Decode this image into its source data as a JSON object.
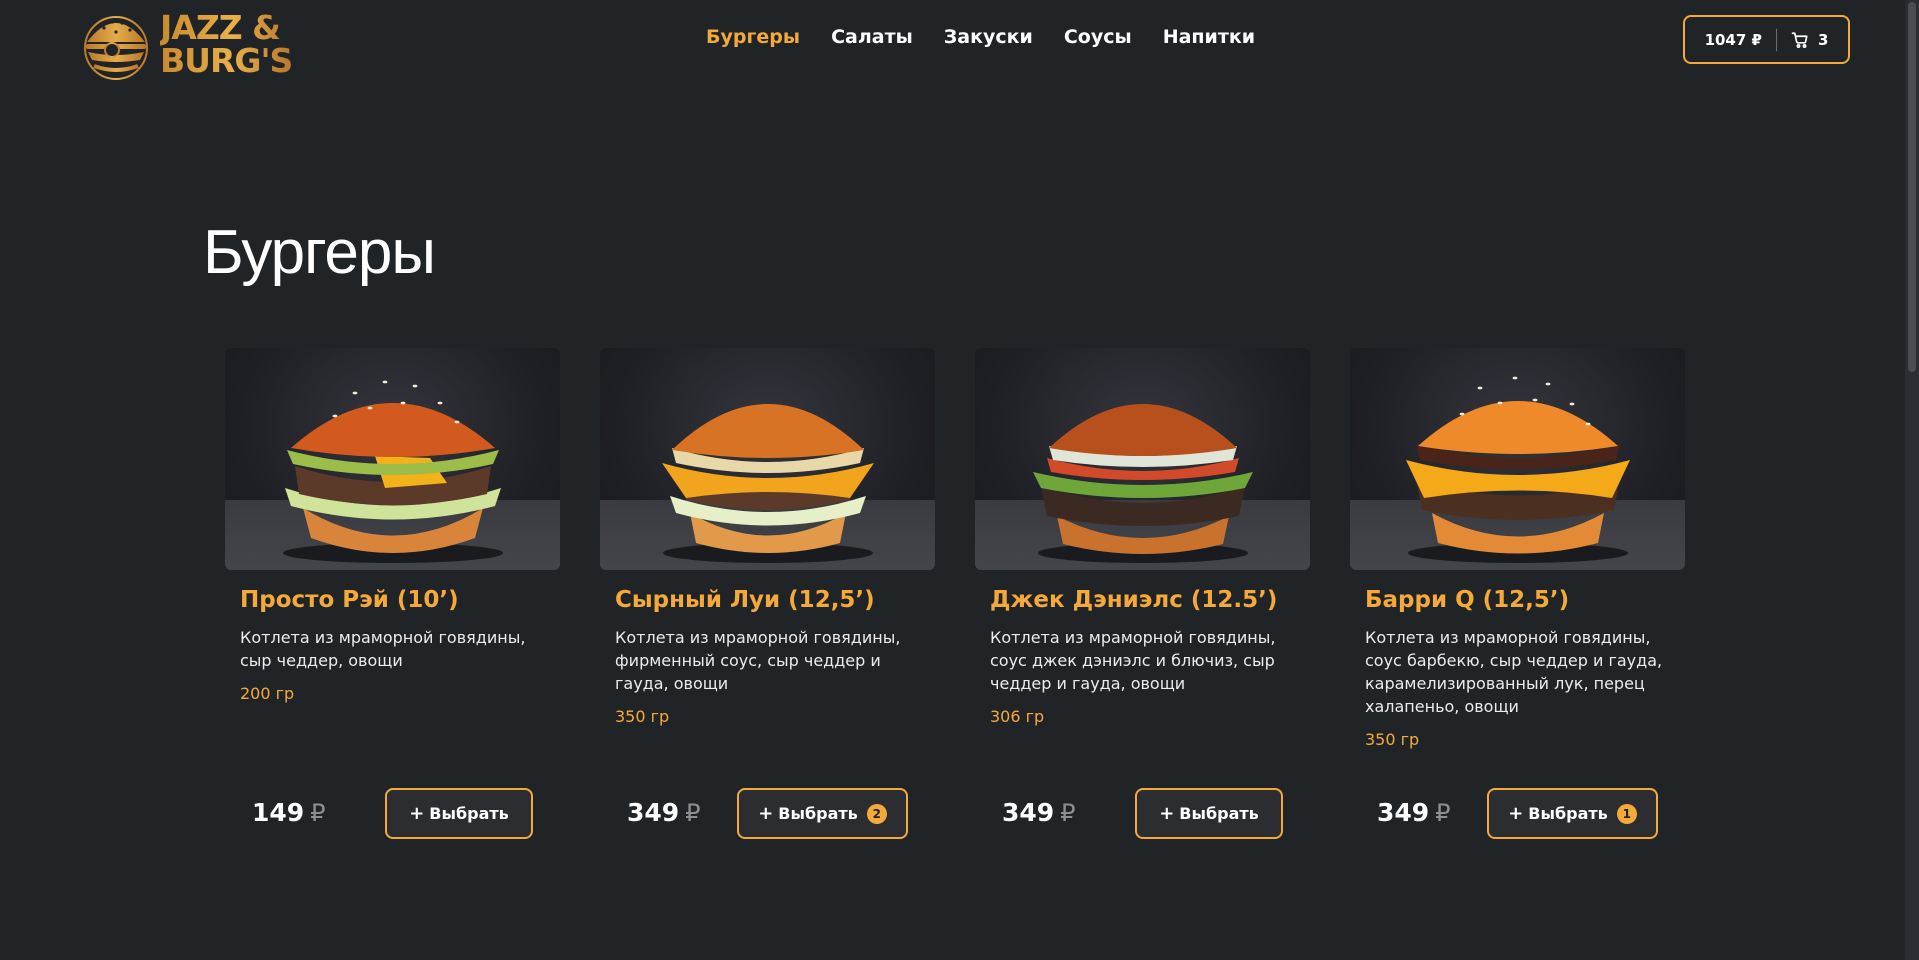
{
  "header": {
    "logo_text_line1": "JAZZ &",
    "logo_text_line2": "BURG'S",
    "nav": [
      {
        "label": "Бургеры",
        "active": true
      },
      {
        "label": "Салаты",
        "active": false
      },
      {
        "label": "Закуски",
        "active": false
      },
      {
        "label": "Соусы",
        "active": false
      },
      {
        "label": "Напитки",
        "active": false
      }
    ],
    "cart": {
      "total": "1047 ₽",
      "count": "3",
      "icon": "cart-icon"
    }
  },
  "page": {
    "title": "Бургеры"
  },
  "products": [
    {
      "name": "Просто Рэй (10’)",
      "description": "Котлета из мраморной говядины, сыр чеддер, овощи",
      "weight": "200 гр",
      "price": "149",
      "currency": "₽",
      "button_label": "Выбрать",
      "badge": ""
    },
    {
      "name": "Сырный Луи (12,5’)",
      "description": "Котлета из мраморной говядины, фирменный соус, сыр чеддер и гауда, овощи",
      "weight": "350 гр",
      "price": "349",
      "currency": "₽",
      "button_label": "Выбрать",
      "badge": "2"
    },
    {
      "name": "Джек Дэниэлс (12.5’)",
      "description": "Котлета из мраморной говядины, соус джек дэниэлс и блючиз, сыр чеддер и гауда, овощи",
      "weight": "306 гр",
      "price": "349",
      "currency": "₽",
      "button_label": "Выбрать",
      "badge": ""
    },
    {
      "name": "Барри Q (12,5’)",
      "description": "Котлета из мраморной говядины, соус барбекю, сыр чеддер и гауда, карамелизированный лук, перец халапеньо, овощи",
      "weight": "350 гр",
      "price": "349",
      "currency": "₽",
      "button_label": "Выбрать",
      "badge": "1"
    }
  ],
  "colors": {
    "accent": "#f5a93a",
    "background": "#212427"
  }
}
